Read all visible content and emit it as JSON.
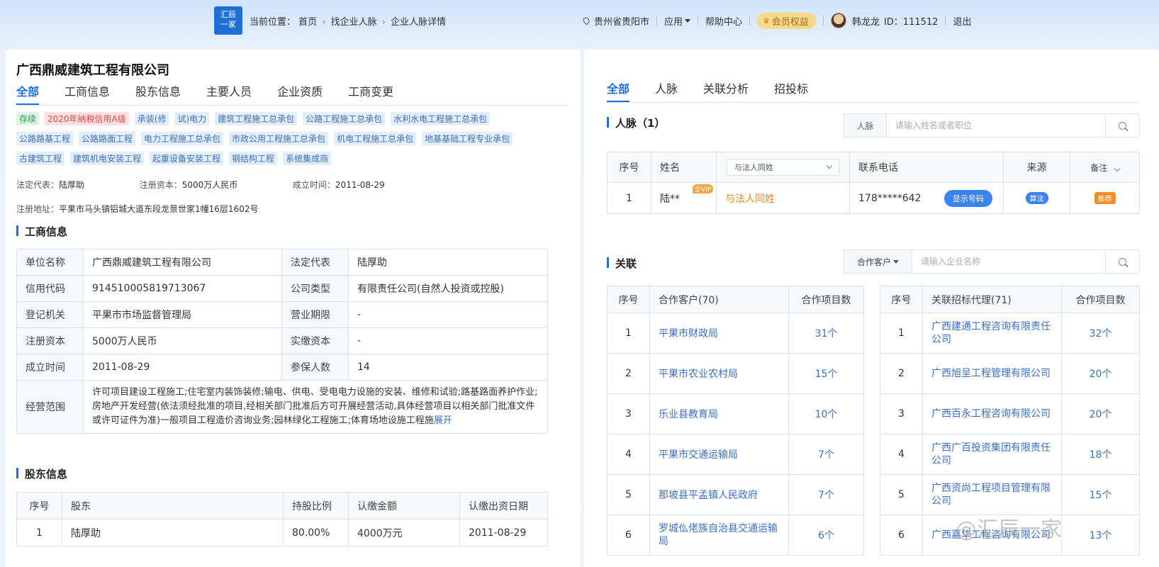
{
  "header": {
    "logo_line1": "汇辰",
    "logo_line2": "一家",
    "breadcrumb_prefix": "当前位置：",
    "breadcrumb": [
      "首页",
      "找企业人脉",
      "企业人脉详情"
    ],
    "location": "贵州省贵阳市",
    "apps": "应用",
    "help": "帮助中心",
    "vip": "会员权益",
    "user_name": "韩龙龙",
    "user_id": "ID：111512",
    "logout": "退出"
  },
  "company": {
    "name": "广西鼎威建筑工程有限公司",
    "tabs": [
      "全部",
      "工商信息",
      "股东信息",
      "主要人员",
      "企业资质",
      "工商变更"
    ],
    "tags_row1": [
      "存续",
      "2020年纳税信用A级",
      "承装(修",
      "试)电力",
      "建筑工程施工总承包",
      "公路工程施工总承包",
      "水利水电工程施工总承包"
    ],
    "tags_row2": [
      "公路路基工程",
      "公路路面工程",
      "电力工程施工总承包",
      "市政公用工程施工总承包",
      "机电工程施工总承包",
      "地基基础工程专业承包"
    ],
    "tags_row3": [
      "古建筑工程",
      "建筑机电安装工程",
      "起重设备安装工程",
      "钢结构工程",
      "系统集成商"
    ],
    "legal_rep_label": "法定代表：",
    "legal_rep": "陆厚助",
    "capital_label": "注册资本：",
    "capital": "5000万人民币",
    "founded_label": "成立时间：",
    "founded": "2011-08-29",
    "address_label": "注册地址：",
    "address": "平果市马头镇铝城大道东段龙景世家1幢16层1602号"
  },
  "business_info": {
    "title": "工商信息",
    "rows": [
      [
        "单位名称",
        "广西鼎威建筑工程有限公司",
        "法定代表",
        "陆厚助"
      ],
      [
        "信用代码",
        "914510005819713067",
        "公司类型",
        "有限责任公司(自然人投资或控股)"
      ],
      [
        "登记机关",
        "平果市市场监督管理局",
        "营业期限",
        "-"
      ],
      [
        "注册资本",
        "5000万人民币",
        "实缴资本",
        "-"
      ],
      [
        "成立时间",
        "2011-08-29",
        "参保人数",
        "14"
      ]
    ],
    "scope_label": "经营范围",
    "scope": "许可项目建设工程施工;住宅室内装饰装修;输电、供电、受电电力设施的安装、维修和试验;路基路面养护作业;房地产开发经营(依法须经批准的项目,经相关部门批准后方可开展经营活动,具体经营项目以相关部门批准文件或许可证件为准)一般项目工程造价咨询业务;园林绿化工程施工;体育场地设施工程施",
    "expand": "展开"
  },
  "shareholders": {
    "title": "股东信息",
    "headers": [
      "序号",
      "股东",
      "持股比例",
      "认缴金额",
      "认缴出资日期"
    ],
    "rows": [
      [
        "1",
        "陆厚助",
        "80.00%",
        "4000万元",
        "2011-08-29"
      ]
    ]
  },
  "right_tabs": [
    "全部",
    "人脉",
    "关联分析",
    "招投标"
  ],
  "contacts": {
    "title": "人脉（1）",
    "search_prefix": "人脉",
    "search_placeholder": "请输入姓名或者职位",
    "headers": {
      "no": "序号",
      "name": "姓名",
      "filter": "与法人同姓",
      "phone": "联系电话",
      "source": "来源",
      "remark": "备注"
    },
    "row": {
      "no": "1",
      "name": "陆**",
      "vip": "企VIP",
      "relation": "与法人同姓",
      "phone": "178*****642",
      "show_btn": "显示号码",
      "source": "算法",
      "remark": "推荐"
    }
  },
  "related": {
    "title": "关联",
    "search_prefix": "合作客户",
    "search_placeholder": "请输入企业名称",
    "clients_headers": [
      "序号",
      "合作客户(70)",
      "合作项目数"
    ],
    "clients": [
      [
        "1",
        "平果市财政局",
        "31个"
      ],
      [
        "2",
        "平果市农业农村局",
        "15个"
      ],
      [
        "3",
        "乐业县教育局",
        "10个"
      ],
      [
        "4",
        "平果市交通运输局",
        "7个"
      ],
      [
        "5",
        "那坡县平孟镇人民政府",
        "7个"
      ],
      [
        "6",
        "罗城仫佬族自治县交通运输局",
        "6个"
      ]
    ],
    "agents_headers": [
      "序号",
      "关联招标代理(71)",
      "合作项目数"
    ],
    "agents": [
      [
        "1",
        "广西建通工程咨询有限责任公司",
        "32个"
      ],
      [
        "2",
        "广西旭呈工程管理有限公司",
        "20个"
      ],
      [
        "3",
        "广西百永工程咨询有限公司",
        "20个"
      ],
      [
        "4",
        "广西广百投资集团有限责任公司",
        "18个"
      ],
      [
        "5",
        "广西资尚工程项目管理有限公司",
        "15个"
      ],
      [
        "6",
        "广西嘉华工程咨询有限公司",
        "13个"
      ]
    ]
  },
  "watermark": "@汇辰一家"
}
